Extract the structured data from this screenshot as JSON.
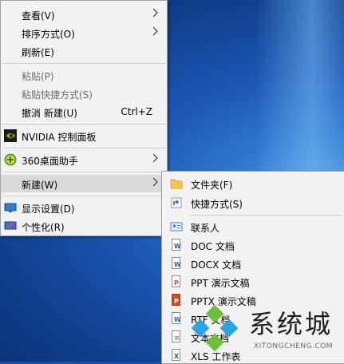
{
  "context_menu": {
    "items": [
      {
        "label": "查看(V)"
      },
      {
        "label": "排序方式(O)"
      },
      {
        "label": "刷新(E)"
      },
      {
        "label": "粘贴(P)"
      },
      {
        "label": "粘贴快捷方式(S)"
      },
      {
        "label": "撤消 新建(U)",
        "shortcut": "Ctrl+Z"
      },
      {
        "label": "NVIDIA 控制面板",
        "icon": "nvidia-icon"
      },
      {
        "label": "360桌面助手",
        "icon": "360-icon"
      },
      {
        "label": "新建(W)"
      },
      {
        "label": "显示设置(D)",
        "icon": "display-icon"
      },
      {
        "label": "个性化(R)",
        "icon": "personalize-icon"
      }
    ]
  },
  "new_submenu": {
    "items": [
      {
        "label": "文件夹(F)",
        "icon": "folder-icon"
      },
      {
        "label": "快捷方式(S)",
        "icon": "shortcut-icon"
      },
      {
        "label": "联系人",
        "icon": "contact-icon"
      },
      {
        "label": "DOC 文档",
        "icon": "word-doc-icon"
      },
      {
        "label": "DOCX 文档",
        "icon": "word-docx-icon"
      },
      {
        "label": "PPT 演示文稿",
        "icon": "ppt-icon"
      },
      {
        "label": "PPTX 演示文稿",
        "icon": "pptx-icon"
      },
      {
        "label": "RTF 文档",
        "icon": "rtf-icon"
      },
      {
        "label": "文本文档",
        "icon": "text-doc-icon"
      },
      {
        "label": "XLS 工作表",
        "icon": "xls-icon"
      }
    ]
  },
  "watermark": {
    "text": "系统城",
    "url": "XITONGCHENG.COM"
  },
  "colors": {
    "menu_bg": "#f2f2f2",
    "highlight": "#dadada",
    "disabled_text": "#6d6d6d",
    "desktop": "#1c56b3"
  }
}
